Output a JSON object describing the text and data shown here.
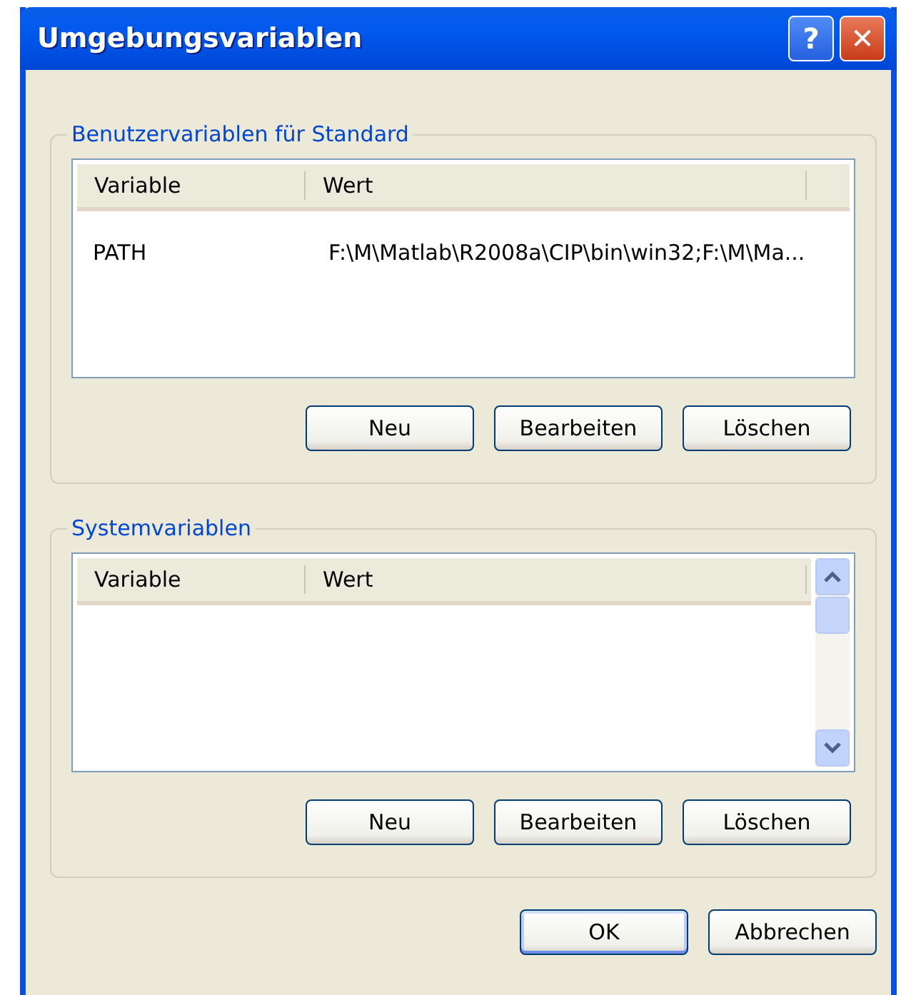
{
  "window": {
    "title": "Umgebungsvariablen",
    "title_buttons": [
      {
        "kind": "help",
        "label": "?"
      },
      {
        "kind": "close",
        "label": "✕"
      }
    ]
  },
  "groups": [
    {
      "title": "Benutzervariablen für Standard",
      "columns": [
        "Variable",
        "Wert"
      ],
      "rows": [
        {
          "variable": "PATH",
          "value": "F:\\M\\Matlab\\R2008a\\CIP\\bin\\win32;F:\\M\\Ma...",
          "selected": false
        }
      ],
      "scrollbar": false,
      "buttons": [
        {
          "label": "Neu",
          "default": false
        },
        {
          "label": "Bearbeiten",
          "default": false
        },
        {
          "label": "Löschen",
          "default": false
        }
      ]
    },
    {
      "title": "Systemvariablen",
      "columns": [
        "Variable",
        "Wert"
      ],
      "scrollbar": true,
      "buttons": [
        {
          "label": "Neu",
          "default": false
        },
        {
          "label": "Bearbeiten",
          "default": false
        },
        {
          "label": "Löschen",
          "default": false
        }
      ]
    }
  ],
  "buttons": [
    {
      "label": "OK",
      "default": true
    },
    {
      "label": "Abbrechen",
      "default": false
    }
  ]
}
